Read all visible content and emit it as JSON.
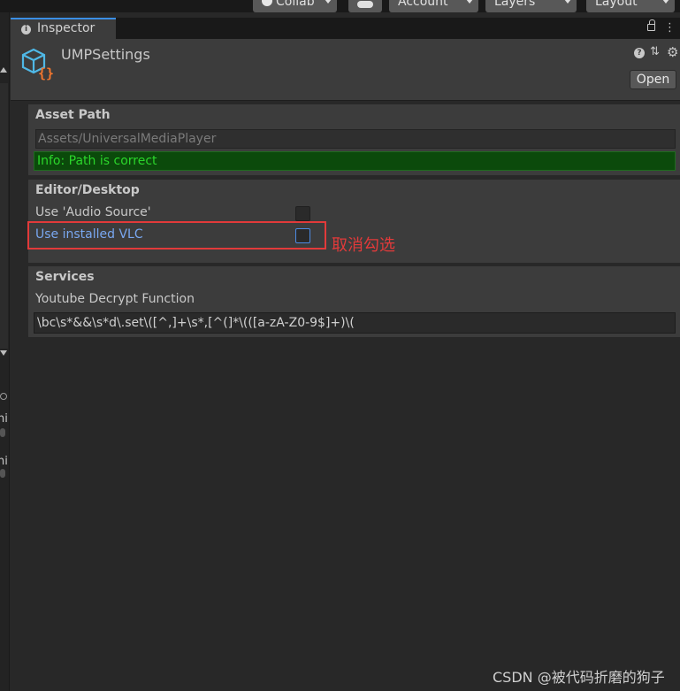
{
  "toolbar": {
    "collab_label": "Collab",
    "account_label": "Account",
    "layers_label": "Layers",
    "layout_label": "Layout"
  },
  "left_panel": {
    "text1": "ni",
    "text2": "ni"
  },
  "inspector": {
    "tab_label": "Inspector",
    "asset_title": "UMPSettings",
    "open_label": "Open"
  },
  "asset_path": {
    "title": "Asset Path",
    "path_value": "Assets/UniversalMediaPlayer",
    "info_text": "Info: Path is correct"
  },
  "editor_desktop": {
    "title": "Editor/Desktop",
    "audio_source_label": "Use 'Audio Source'",
    "audio_source_checked": false,
    "vlc_label": "Use installed VLC",
    "vlc_checked": false
  },
  "services": {
    "title": "Services",
    "decrypt_label": "Youtube Decrypt Function",
    "decrypt_value": "\\bc\\s*&&\\s*d\\.set\\([^,]+\\s*,[^(]*\\(([a-zA-Z0-9$]+)\\("
  },
  "annotation": {
    "text": "取消勾选",
    "color": "#e23a3a"
  },
  "watermark": "CSDN @被代码折磨的狗子"
}
